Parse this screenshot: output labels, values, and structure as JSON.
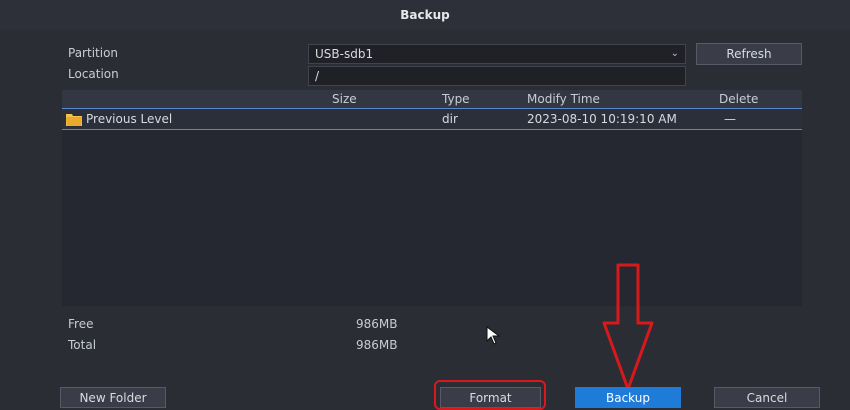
{
  "window": {
    "title": "Backup"
  },
  "form": {
    "partition_label": "Partition",
    "partition_value": "USB-sdb1",
    "dropdown_arrow": "⌄",
    "location_label": "Location",
    "location_value": "/",
    "refresh_label": "Refresh"
  },
  "table": {
    "headers": {
      "size": "Size",
      "type": "Type",
      "modify_time": "Modify Time",
      "delete": "Delete"
    },
    "rows": [
      {
        "name": "Previous Level",
        "size": "",
        "type": "dir",
        "modify_time": "2023-08-10 10:19:10 AM",
        "delete": "—"
      }
    ]
  },
  "storage": {
    "free_label": "Free",
    "free_value": "986MB",
    "total_label": "Total",
    "total_value": "986MB"
  },
  "buttons": {
    "new_folder": "New Folder",
    "format": "Format",
    "backup": "Backup",
    "cancel": "Cancel"
  },
  "colors": {
    "primary_button": "#1e7bd8",
    "annotation_red": "#d8191c",
    "folder_yellow": "#f2c14e"
  },
  "icons": {
    "folder": "folder-icon",
    "dropdown": "chevron-down-icon",
    "cursor": "mouse-pointer-icon",
    "annotation_arrow": "down-arrow-annotation-icon"
  }
}
